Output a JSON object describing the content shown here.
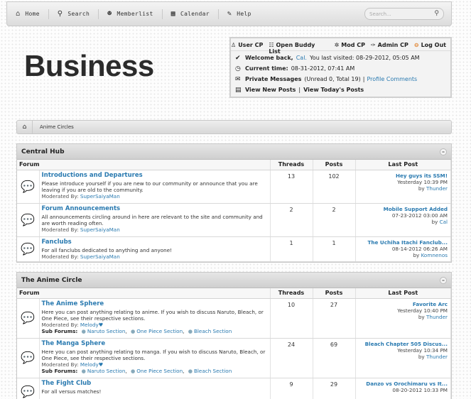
{
  "nav": {
    "items": [
      {
        "label": "Home",
        "icon": "home-icon"
      },
      {
        "label": "Search",
        "icon": "search-icon"
      },
      {
        "label": "Memberlist",
        "icon": "users-icon"
      },
      {
        "label": "Calendar",
        "icon": "calendar-icon"
      },
      {
        "label": "Help",
        "icon": "help-icon"
      }
    ],
    "search_placeholder": "Search..."
  },
  "logo": "Business",
  "userbox": {
    "links": [
      "User CP",
      "Open Buddy List",
      "Mod CP",
      "Admin CP",
      "Log Out"
    ],
    "welcome_label": "Welcome back,",
    "username": "Cal.",
    "last_visited": "You last visited: 08-29-2012, 05:05 AM",
    "current_time_label": "Current time:",
    "current_time": "08-31-2012, 07:41 AM",
    "pm_label": "Private Messages",
    "pm_counts": "(Unread 0, Total 19)",
    "pm_sep": "|",
    "profile_comments": "Profile Comments",
    "view_new_posts": "View New Posts",
    "view_sep": "|",
    "view_today": "View Today's Posts"
  },
  "breadcrumb": {
    "label": "Anime Circles"
  },
  "columns": {
    "forum": "Forum",
    "threads": "Threads",
    "posts": "Posts",
    "last_post": "Last Post"
  },
  "moderated_label": "Moderated By:",
  "subforums_label": "Sub Forums:",
  "by_label": "by",
  "categories": [
    {
      "title": "Central Hub",
      "forums": [
        {
          "title": "Introductions and Departures",
          "desc": "Please introduce yourself if you are new to our community or announce that you are leaving if you are old to the community.",
          "mod": "SuperSaiyaMan",
          "threads": "13",
          "posts": "102",
          "lp_title": "Hey guys its SSM!",
          "lp_date": "Yesterday 10:39 PM",
          "lp_user": "Thunder",
          "unread": true
        },
        {
          "title": "Forum Announcements",
          "desc": "All announcements circling around in here are relevant to the site and community and are worth reading often.",
          "mod": "SuperSaiyaMan",
          "threads": "2",
          "posts": "2",
          "lp_title": "Mobile Support Added",
          "lp_date": "07-23-2012 03:00 AM",
          "lp_user": "Cal",
          "unread": false
        },
        {
          "title": "Fanclubs",
          "desc": "For all fanclubs dedicated to anything and anyone!",
          "mod": "SuperSaiyaMan",
          "threads": "1",
          "posts": "1",
          "lp_title": "The Uchiha Itachi Fanclub...",
          "lp_date": "08-14-2012 06:26 AM",
          "lp_user": "Komnenos",
          "unread": false
        }
      ]
    },
    {
      "title": "The Anime Circle",
      "forums": [
        {
          "title": "The Anime Sphere",
          "desc": "Here you can post anything relating to anime. If you wish to discuss Naruto, Bleach, or One Piece, see their respective sections.",
          "mod": "Melody♥",
          "subs": [
            "Naruto Section",
            "One Piece Section",
            "Bleach Section"
          ],
          "threads": "10",
          "posts": "27",
          "lp_title": "Favorite Arc",
          "lp_date": "Yesterday 10:40 PM",
          "lp_user": "Thunder",
          "unread": true
        },
        {
          "title": "The Manga Sphere",
          "desc": "Here you can post anything relating to manga. If you wish to discuss Naruto, Bleach, or One Piece, see their respective sections.",
          "mod": "Melody♥",
          "subs": [
            "Naruto Section",
            "One Piece Section",
            "Bleach Section"
          ],
          "threads": "24",
          "posts": "69",
          "lp_title": "Bleach Chapter 505 Discus...",
          "lp_date": "Yesterday 10:34 PM",
          "lp_user": "Thunder",
          "unread": true
        },
        {
          "title": "The Fight Club",
          "desc": "For all versus matches!",
          "threads": "9",
          "posts": "29",
          "lp_title": "Danzo vs Orochimaru vs It...",
          "lp_date": "08-20-2012 10:33 PM",
          "lp_user": "",
          "unread": true
        }
      ]
    }
  ]
}
